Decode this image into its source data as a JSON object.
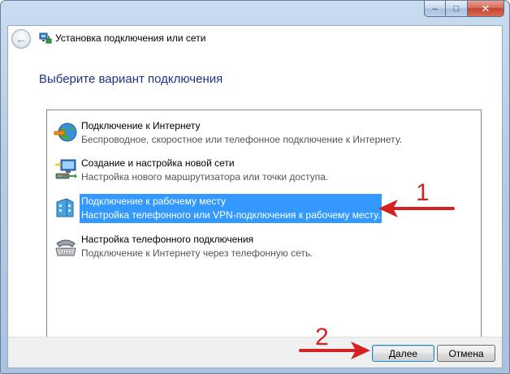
{
  "window": {
    "title": "Установка подключения или сети",
    "caption_min": "–",
    "caption_max": "□",
    "caption_close": "✕"
  },
  "heading": "Выберите вариант подключения",
  "options": [
    {
      "icon": "internet-globe-icon",
      "title": "Подключение к Интернету",
      "description": "Беспроводное, скоростное или телефонное подключение к Интернету.",
      "selected": false
    },
    {
      "icon": "new-network-icon",
      "title": "Создание и настройка новой сети",
      "description": "Настройка нового маршрутизатора или точки доступа.",
      "selected": false
    },
    {
      "icon": "workplace-icon",
      "title": "Подключение к рабочему месту",
      "description": "Настройка телефонного или VPN-подключения к рабочему месту.",
      "selected": true
    },
    {
      "icon": "dialup-phone-icon",
      "title": "Настройка телефонного подключения",
      "description": "Подключение к Интернету через телефонную сеть.",
      "selected": false
    }
  ],
  "buttons": {
    "next": "Далее",
    "cancel": "Отмена"
  },
  "annotations": {
    "marker_1": "1",
    "marker_2": "2",
    "color": "#d42121"
  },
  "colors": {
    "selection": "#3399ff",
    "heading": "#1e3287"
  }
}
